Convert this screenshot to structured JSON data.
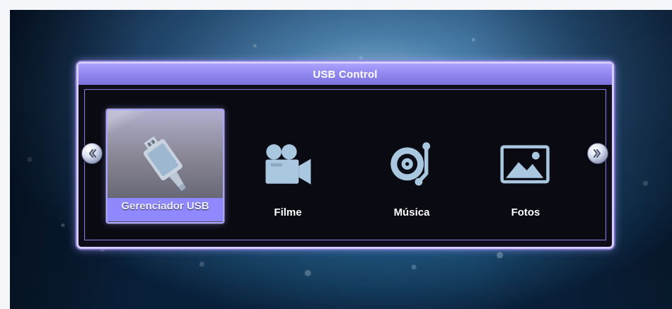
{
  "window": {
    "title": "USB Control"
  },
  "navigation": {
    "previous_icon": "double-chevron-left-icon",
    "next_icon": "double-chevron-right-icon"
  },
  "menu": {
    "items": [
      {
        "label": "Gerenciador USB",
        "icon": "usb-drive-icon",
        "selected": true
      },
      {
        "label": "Filme",
        "icon": "video-camera-icon",
        "selected": false
      },
      {
        "label": "Música",
        "icon": "music-record-icon",
        "selected": false
      },
      {
        "label": "Fotos",
        "icon": "photo-landscape-icon",
        "selected": false
      }
    ]
  },
  "colors": {
    "window_border": "#d6ccff",
    "title_bar": "#8f87f5",
    "selected_item": "#8f88ff",
    "icon": "#a6c8df"
  }
}
